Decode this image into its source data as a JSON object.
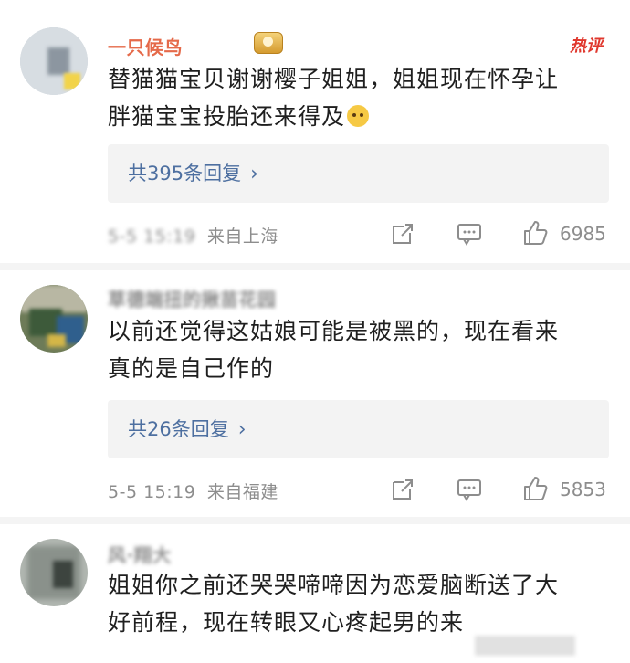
{
  "comments": [
    {
      "username": "一只候鸟",
      "hot_label": "热评",
      "text_line1": "替猫猫宝贝谢谢樱子姐姐，姐姐现在怀孕让",
      "text_line2": "胖猫宝宝投胎还来得及",
      "replies": "共395条回复",
      "timestamp": "5-5 15:19",
      "location": "来自上海",
      "likes": "6985"
    },
    {
      "username": "草德端扭的揪苗花园",
      "text_line1": "以前还觉得这姑娘可能是被黑的，现在看来",
      "text_line2": "真的是自己作的",
      "replies": "共26条回复",
      "timestamp": "5-5 15:19",
      "location": "来自福建",
      "likes": "5853"
    },
    {
      "username": "风·翔大",
      "text_line1": "姐姐你之前还哭哭啼啼因为恋爱脑断送了大",
      "text_line2": "好前程，现在转眼又心疼起男的来"
    }
  ],
  "colors": {
    "link": "#4d6fa0",
    "hot": "#e0382e",
    "meta": "#8d8d8d",
    "reply_bg": "#f3f3f3"
  },
  "icons": {
    "badge": "fan-badge-icon",
    "emoji": "hugging-emoji-icon",
    "share": "share-icon",
    "comment": "comment-icon",
    "like": "thumbs-up-icon",
    "chevron": "chevron-right-icon"
  }
}
